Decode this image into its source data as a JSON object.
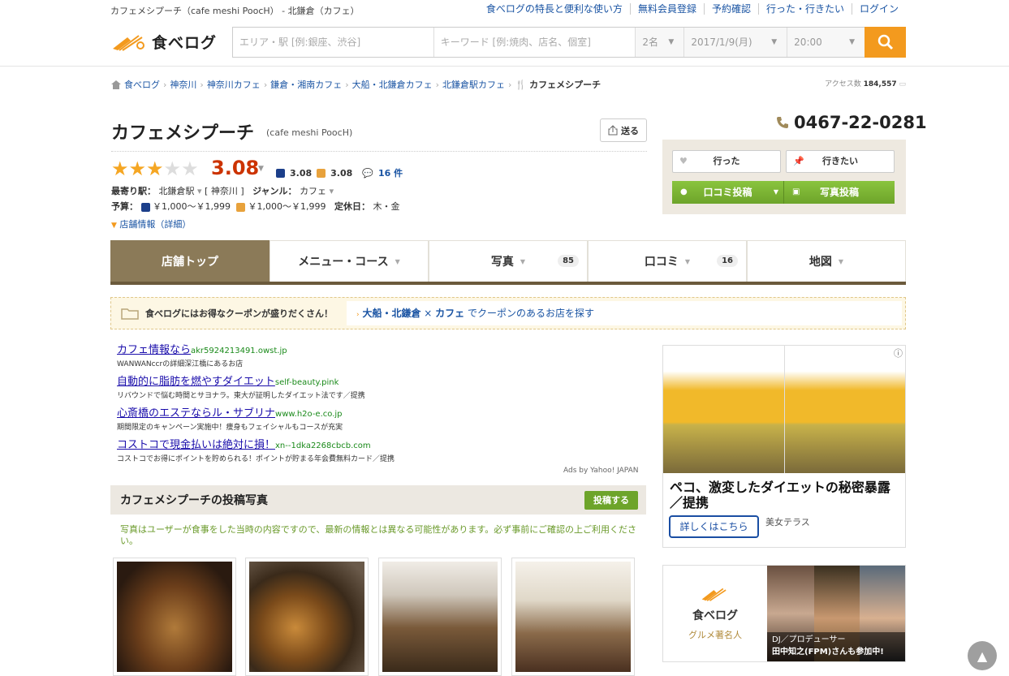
{
  "site_title": "カフェメシプーチ（cafe meshi PoocH） - 北鎌倉（カフェ）",
  "topnav": [
    "食べログの特長と便利な使い方",
    "無料会員登録",
    "予約確認",
    "行った・行きたい",
    "ログイン"
  ],
  "logo_text": "食べログ",
  "search": {
    "area_placeholder": "エリア・駅 [例:銀座、渋谷]",
    "keyword_placeholder": "キーワード [例:焼肉、店名、個室]",
    "people": "2名",
    "date": "2017/1/9(月)",
    "time": "20:00"
  },
  "breadcrumb": [
    "食べログ",
    "神奈川",
    "神奈川カフェ",
    "鎌倉・湘南カフェ",
    "大船・北鎌倉カフェ",
    "北鎌倉駅カフェ",
    "カフェメシプーチ"
  ],
  "access": {
    "label": "アクセス数",
    "count": "184,557"
  },
  "restaurant": {
    "name": "カフェメシプーチ",
    "name_en": "(cafe meshi PoocH)",
    "send_label": "送る",
    "rating": 3.08,
    "score": "3.08",
    "dinner_score": "3.08",
    "lunch_score": "3.08",
    "review_count": "16 件",
    "station_label": "最寄り駅：",
    "station": "北鎌倉駅",
    "pref": "[ 神奈川 ]",
    "genre_label": "ジャンル：",
    "genre": "カフェ",
    "budget_label": "予算：",
    "budget_dinner": "￥1,000～￥1,999",
    "budget_lunch": "￥1,000～￥1,999",
    "holiday_label": "定休日：",
    "holiday": "木・金",
    "shop_info": "店舗情報（詳細）",
    "phone": "0467-22-0281"
  },
  "actions": {
    "went": "行った",
    "want": "行きたい",
    "review": "口コミ投稿",
    "photo": "写真投稿"
  },
  "tabs": [
    {
      "label": "店舗トップ",
      "count": ""
    },
    {
      "label": "メニュー・コース",
      "count": ""
    },
    {
      "label": "写真",
      "count": "85"
    },
    {
      "label": "口コミ",
      "count": "16"
    },
    {
      "label": "地図",
      "count": ""
    }
  ],
  "coupon": {
    "left": "食べログにはお得なクーポンが盛りだくさん！",
    "area": "大船・北鎌倉",
    "cross": "×",
    "genre": "カフェ",
    "rest": "でクーポンのあるお店を探す"
  },
  "ads": [
    {
      "title": "カフェ情報なら",
      "url": "akr5924213491.owst.jp",
      "desc": "WANWANccrの詳細深江橋にあるお店"
    },
    {
      "title": "自動的に脂肪を燃やすダイエット",
      "url": "self-beauty.pink",
      "desc": "リバウンドで悩む時間とサヨナラ。東大が証明したダイエット法です／提携"
    },
    {
      "title": "心斎橋のエステならル・サブリナ",
      "url": "www.h2o-e.co.jp",
      "desc": "期間限定のキャンペーン実施中！痩身もフェイシャルもコースが充実"
    },
    {
      "title": "コストコで現金払いは絶対に損！",
      "url": "xn--1dka2268cbcb.com",
      "desc": "コストコでお得にポイントを貯められる！ポイントが貯まる年会費無料カード／提携"
    }
  ],
  "ads_by": "Ads by Yahoo! JAPAN",
  "photos": {
    "heading": "カフェメシプーチの投稿写真",
    "post_label": "投稿する",
    "note": "写真はユーザーが食事をした当時の内容ですので、最新の情報とは異なる可能性があります。必ず事前にご確認の上ご利用ください。"
  },
  "side_ad": {
    "headline": "ペコ、激変したダイエットの秘密暴露／提携",
    "cta": "詳しくはこちら",
    "brand": "美女テラス"
  },
  "banner": {
    "logo": "食べログ",
    "sub": "グルメ著名人",
    "caption1": "DJ／プロデューサー",
    "caption2": "田中知之(FPM)さんも参加中!"
  },
  "colors": {
    "accent": "#f39a1e",
    "score": "#cc3300",
    "green": "#6da42a",
    "tab_active": "#8b7a58"
  }
}
